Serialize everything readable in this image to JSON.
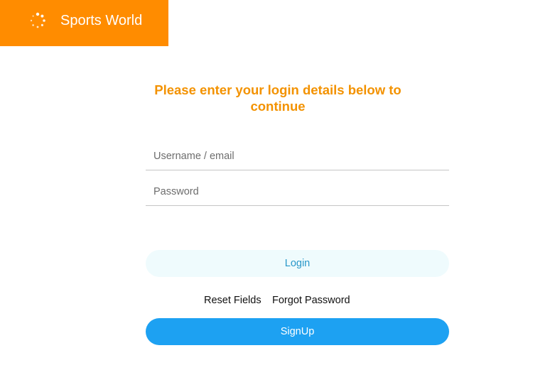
{
  "header": {
    "brand_name": "Sports World",
    "brand_color": "#ff8c00",
    "logo_icon": "loading-spinner-icon"
  },
  "login_form": {
    "heading": "Please enter your login details below to continue",
    "heading_color": "#f39200",
    "username": {
      "placeholder": "Username / email",
      "value": ""
    },
    "password": {
      "placeholder": "Password",
      "value": ""
    },
    "login_label": "Login",
    "reset_label": "Reset Fields",
    "forgot_label": "Forgot Password",
    "signup_label": "SignUp",
    "signup_color": "#1da1f2",
    "login_color": "#effbfd"
  }
}
